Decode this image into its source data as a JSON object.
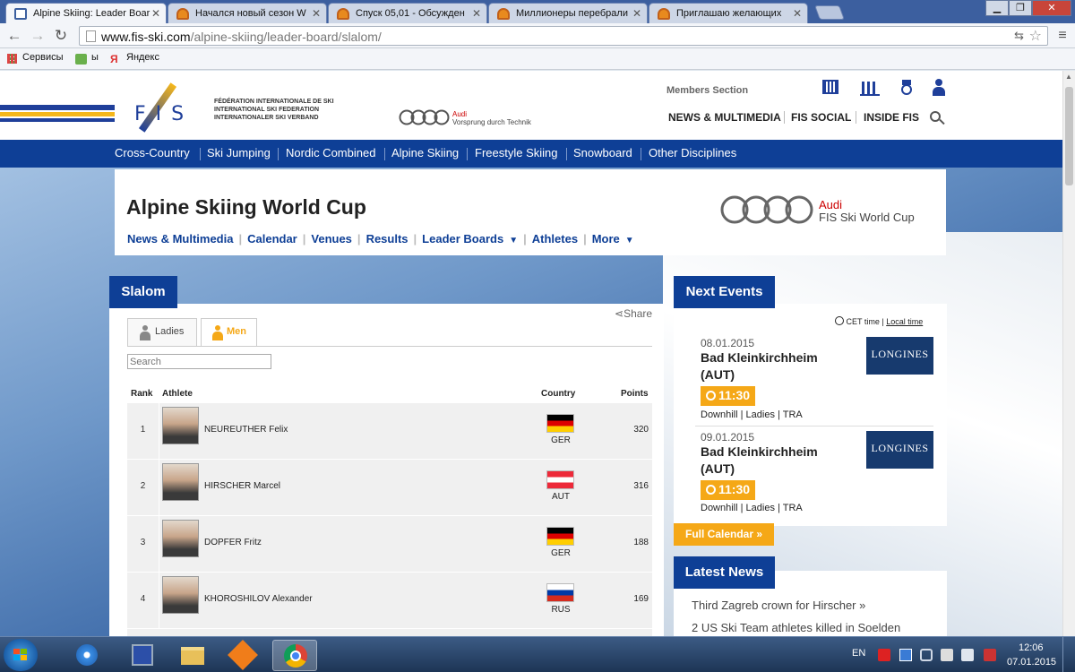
{
  "browser": {
    "tabs": [
      {
        "title": "Alpine Skiing: Leader Boar",
        "active": true
      },
      {
        "title": "Начался новый сезон W",
        "active": false
      },
      {
        "title": "Спуск 05,01 - Обсужден",
        "active": false
      },
      {
        "title": "Миллионеры перебрали",
        "active": false
      },
      {
        "title": "Приглашаю желающих",
        "active": false
      }
    ],
    "url_domain": "www.fis-ski.com",
    "url_path": "/alpine-skiing/leader-board/slalom/",
    "bookmarks": [
      "Сервисы",
      "ы",
      "Яндекс"
    ]
  },
  "site": {
    "fis_logo": "F I S",
    "federation_lines": [
      "FÉDÉRATION INTERNATIONALE DE SKI",
      "INTERNATIONAL SKI FEDERATION",
      "INTERNATIONALER SKI VERBAND"
    ],
    "sponsor_small": {
      "brand": "Audi",
      "tagline": "Vorsprung durch Technik"
    },
    "members_section": "Members Section",
    "top_links": [
      "NEWS & MULTIMEDIA",
      "FIS SOCIAL",
      "INSIDE FIS"
    ],
    "nav": [
      "Cross-Country",
      "Ski Jumping",
      "Nordic Combined",
      "Alpine Skiing",
      "Freestyle Skiing",
      "Snowboard",
      "Other Disciplines"
    ]
  },
  "world_cup": {
    "title": "Alpine Skiing World Cup",
    "menu": [
      "News & Multimedia",
      "Calendar",
      "Venues",
      "Results",
      "Leader Boards",
      "Athletes",
      "More"
    ],
    "sponsor": {
      "brand": "Audi",
      "name": "FIS Ski World Cup"
    }
  },
  "leaderboard": {
    "header": "Slalom",
    "share": "Share",
    "tabs": [
      "Ladies",
      "Men"
    ],
    "active_tab": "Men",
    "search_placeholder": "Search",
    "columns": [
      "Rank",
      "Athlete",
      "Country",
      "Points"
    ],
    "rows": [
      {
        "rank": "1",
        "athlete": "NEUREUTHER Felix",
        "country": "GER",
        "points": "320"
      },
      {
        "rank": "2",
        "athlete": "HIRSCHER Marcel",
        "country": "AUT",
        "points": "316"
      },
      {
        "rank": "3",
        "athlete": "DOPFER Fritz",
        "country": "GER",
        "points": "188"
      },
      {
        "rank": "4",
        "athlete": "KHOROSHILOV Alexander",
        "country": "RUS",
        "points": "169"
      }
    ]
  },
  "next_events": {
    "header": "Next Events",
    "cet": "CET time",
    "local": "Local time",
    "sponsor": "LONGINES",
    "events": [
      {
        "date": "08.01.2015",
        "place": "Bad Kleinkirchheim",
        "country": "(AUT)",
        "time": "11:30",
        "meta": "Downhill | Ladies | TRA"
      },
      {
        "date": "09.01.2015",
        "place": "Bad Kleinkirchheim",
        "country": "(AUT)",
        "time": "11:30",
        "meta": "Downhill | Ladies | TRA"
      }
    ],
    "full_calendar": "Full Calendar »"
  },
  "latest_news": {
    "header": "Latest News",
    "items": [
      "Third Zagreb crown for Hirscher »",
      "2 US Ski Team athletes killed in Soelden"
    ]
  },
  "taskbar": {
    "lang": "EN",
    "time": "12:06",
    "date": "07.01.2015"
  },
  "colors": {
    "fis_blue": "#0e3f96",
    "accent_orange": "#f5a817"
  }
}
